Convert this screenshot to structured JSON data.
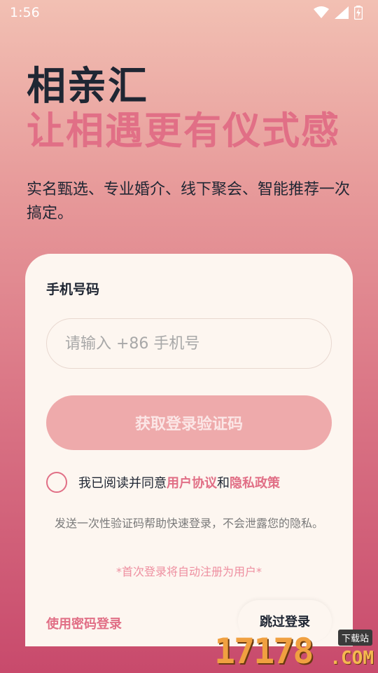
{
  "status_bar": {
    "time": "1:56",
    "icons": [
      "wifi-icon",
      "signal-icon",
      "battery-charging-icon"
    ]
  },
  "hero": {
    "app_name": "相亲汇",
    "slogan": "让相遇更有仪式感",
    "intro": "实名甄选、专业婚介、线下聚会、智能推荐一次搞定。"
  },
  "login_card": {
    "phone_label": "手机号码",
    "phone_value": "",
    "phone_placeholder": "请输入 +86 手机号",
    "get_code_button": "获取登录验证码",
    "agreement": {
      "checked": false,
      "prefix": "我已阅读并同意",
      "user_agreement": "用户协议",
      "conjunction": "和",
      "privacy_policy": "隐私政策"
    },
    "privacy_note": "发送一次性验证码帮助快速登录，不会泄露您的隐私。",
    "auto_register_note": "*首次登录将自动注册为用户*",
    "password_login": "使用密码登录",
    "skip_login": "跳过登录"
  },
  "watermark": {
    "digits": "17178",
    "domain": ".COM",
    "badge": "下载站"
  },
  "colors": {
    "accent": "#e16f86",
    "button_disabled": "#eeaaab",
    "card_bg": "#fdf6f0",
    "title_dark": "#1f2633"
  }
}
